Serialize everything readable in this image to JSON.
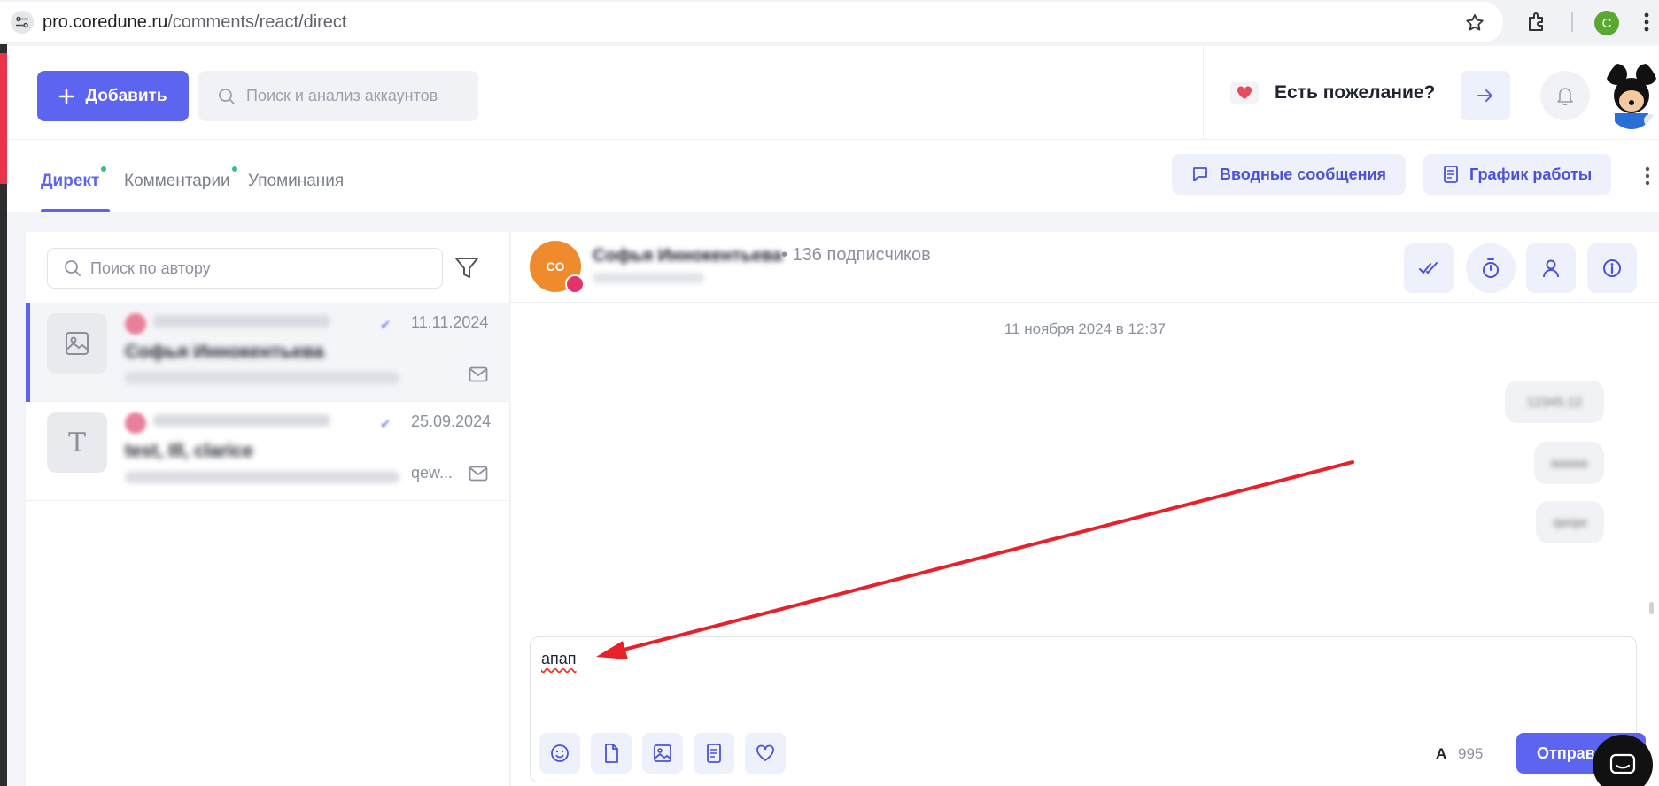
{
  "browser": {
    "url_host": "pro.coredune.ru",
    "url_path": "/comments/react/direct",
    "profile_letter": "C"
  },
  "header": {
    "add_label": "Добавить",
    "search_placeholder": "Поиск и анализ аккаунтов",
    "wish_label": "Есть пожелание?"
  },
  "tabs": [
    {
      "label": "Директ",
      "active": true,
      "dot": true
    },
    {
      "label": "Комментарии",
      "active": false,
      "dot": true
    },
    {
      "label": "Упоминания",
      "active": false,
      "dot": false
    }
  ],
  "toolbar": {
    "intro_label": "Вводные сообщения",
    "schedule_label": "График работы"
  },
  "left_panel": {
    "author_search_placeholder": "Поиск по автору",
    "conversations": [
      {
        "name": "Софья Иннокентьева",
        "date": "11.11.2024",
        "preview_suffix": "",
        "thumb_icon": "image-icon"
      },
      {
        "name": "test, Ill, clarice",
        "date": "25.09.2024",
        "preview_suffix": "qew...",
        "thumb_icon": "text-icon"
      }
    ]
  },
  "chat": {
    "avatar_initials": "CO",
    "name": "Софья Иннокентьева",
    "subscribers": "• 136 подписчиков",
    "date_stamp": "11 ноября 2024 в 12:37",
    "messages": [
      "12345.12",
      "ааааа",
      "qwqw"
    ],
    "composer_text": "апап",
    "font_label": "A",
    "char_counter": "995",
    "send_label": "Отправить"
  },
  "colors": {
    "accent": "#5c64f0",
    "annotation_arrow": "#e8202a"
  }
}
